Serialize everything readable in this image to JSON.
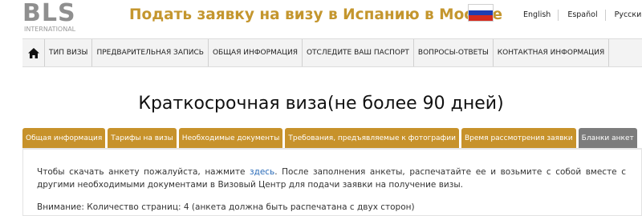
{
  "header": {
    "logo_text": "BLS",
    "logo_subtext": "INTERNATIONAL",
    "title": "Подать заявку на визу в Испанию в Москве",
    "flag": "russia-flag",
    "languages": [
      "English",
      "Español",
      "Русский"
    ]
  },
  "nav": {
    "home_icon": "home-icon",
    "items": [
      "ТИП ВИЗЫ",
      "ПРЕДВАРИТЕЛЬНАЯ ЗАПИСЬ",
      "ОБЩАЯ ИНФОРМАЦИЯ",
      "ОТСЛЕДИТЕ ВАШ ПАСПОРТ",
      "ВОПРОСЫ-ОТВЕТЫ",
      "КОНТАКТНАЯ ИНФОРМАЦИЯ"
    ]
  },
  "main": {
    "title": "Краткосрочная виза(не более 90 дней)",
    "tabs": [
      {
        "label": "Общая информация",
        "active": false
      },
      {
        "label": "Тарифы на визы",
        "active": false
      },
      {
        "label": "Необходимые документы",
        "active": false
      },
      {
        "label": "Требования, предъявляемые к фотографии",
        "active": false
      },
      {
        "label": "Время рассмотрения заявки",
        "active": false
      },
      {
        "label": "Бланки анкет",
        "active": true
      }
    ],
    "content": {
      "text_before_link": "Чтобы скачать анкету пожалуйста, нажмите ",
      "link_text": "здесь",
      "text_after_link": ". После заполнения анкеты, распечатайте ее и возьмите с собой вместе с другими необходимыми документами в Визовый Центр для подачи заявки на получение визы.",
      "note": "Внимание: Количество страниц: 4 (анкета должна быть распечатана с двух сторон)"
    }
  },
  "colors": {
    "accent_gold": "#c4962e",
    "tab_gold": "#c7922b",
    "tab_active_gray": "#7c7c7c",
    "link_blue": "#2a6bb8"
  }
}
